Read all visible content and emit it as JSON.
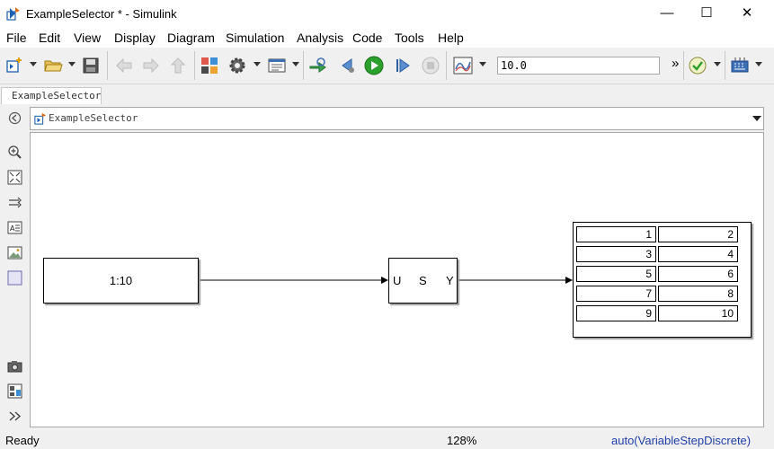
{
  "window": {
    "title": "ExampleSelector * - Simulink",
    "minimize": "—",
    "maximize": "☐",
    "close": "✕"
  },
  "menu": [
    "File",
    "Edit",
    "View",
    "Display",
    "Diagram",
    "Simulation",
    "Analysis",
    "Code",
    "Tools",
    "Help"
  ],
  "toolbar": {
    "stop_time": "10.0",
    "more": "»"
  },
  "tab": {
    "label": "ExampleSelector"
  },
  "address": {
    "path": "ExampleSelector"
  },
  "diagram": {
    "constant_block": {
      "value": "1:10"
    },
    "selector_block": {
      "in_port": "U",
      "name": "S",
      "out_port": "Y"
    },
    "display_block": {
      "values": [
        "1",
        "2",
        "3",
        "4",
        "5",
        "6",
        "7",
        "8",
        "9",
        "10"
      ]
    }
  },
  "status": {
    "state": "Ready",
    "zoom": "128%",
    "solver": "auto(VariableStepDiscrete)"
  },
  "colors": {
    "run_green": "#2ca02c",
    "solver_blue": "#1f3ea8"
  }
}
